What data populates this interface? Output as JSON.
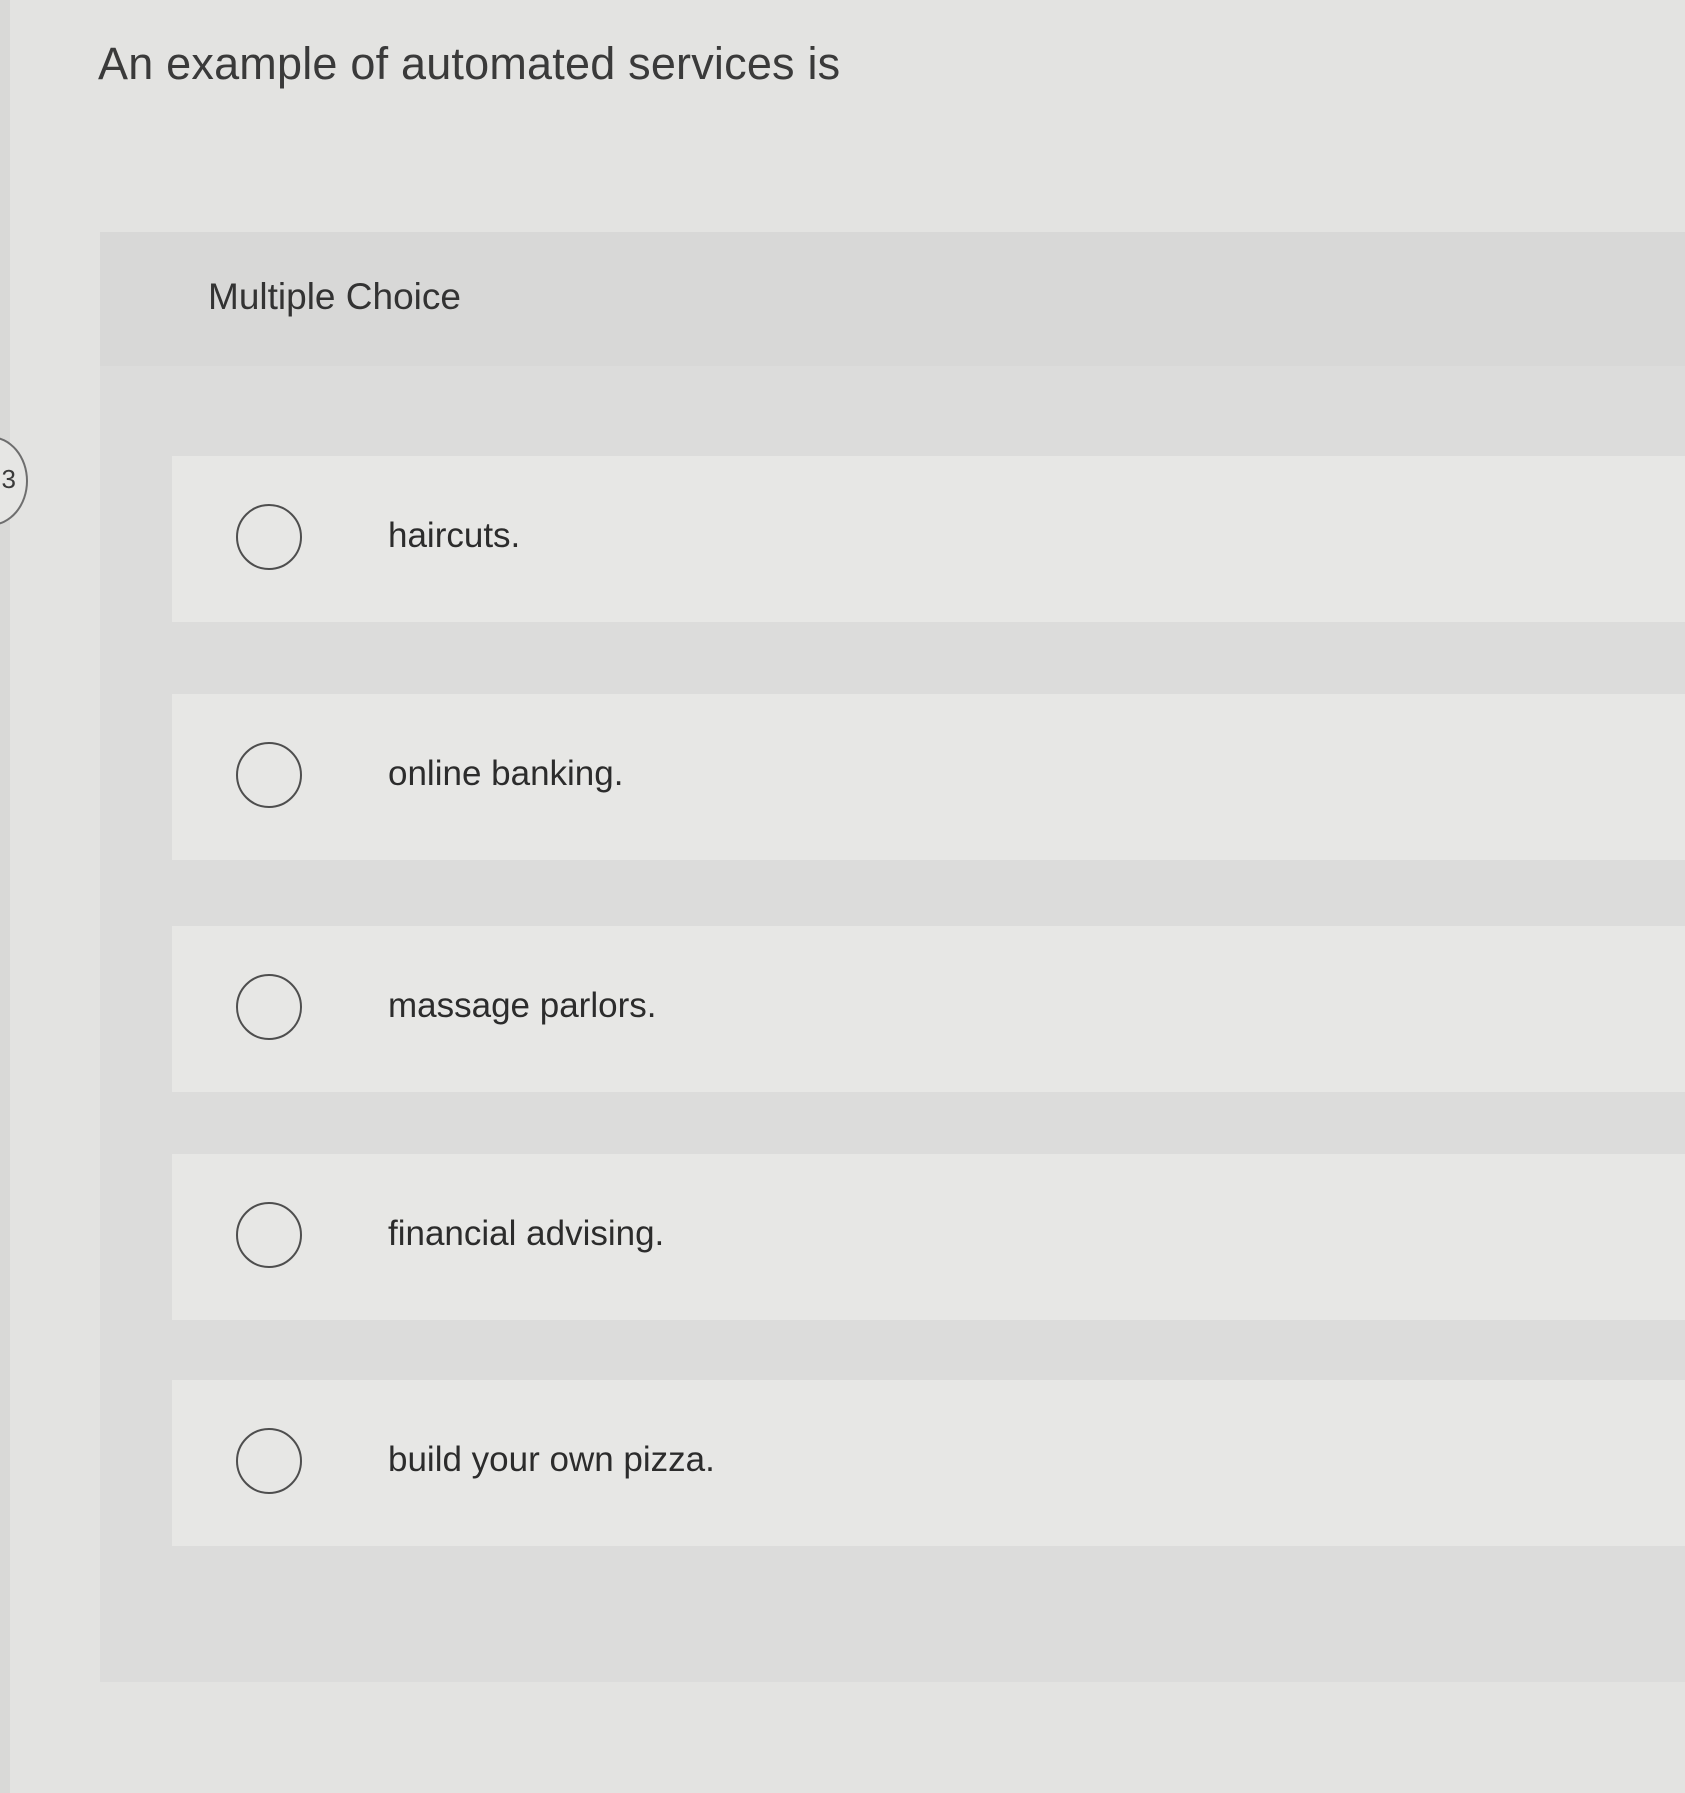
{
  "question": {
    "prompt": "An example of automated services is",
    "type_label": "Multiple Choice",
    "side_marker": "3"
  },
  "choices": [
    {
      "label": "haircuts.",
      "selected": false
    },
    {
      "label": "online banking.",
      "selected": false
    },
    {
      "label": "massage parlors.",
      "selected": false
    },
    {
      "label": "financial advising.",
      "selected": false
    },
    {
      "label": "build your own pizza.",
      "selected": false
    }
  ],
  "colors": {
    "background": "#e3e3e1",
    "panel": "#dcdcdb",
    "row": "#e7e7e5",
    "text": "#2e2e2e"
  },
  "icons": {
    "choice_radio": "radio-circle-icon"
  }
}
